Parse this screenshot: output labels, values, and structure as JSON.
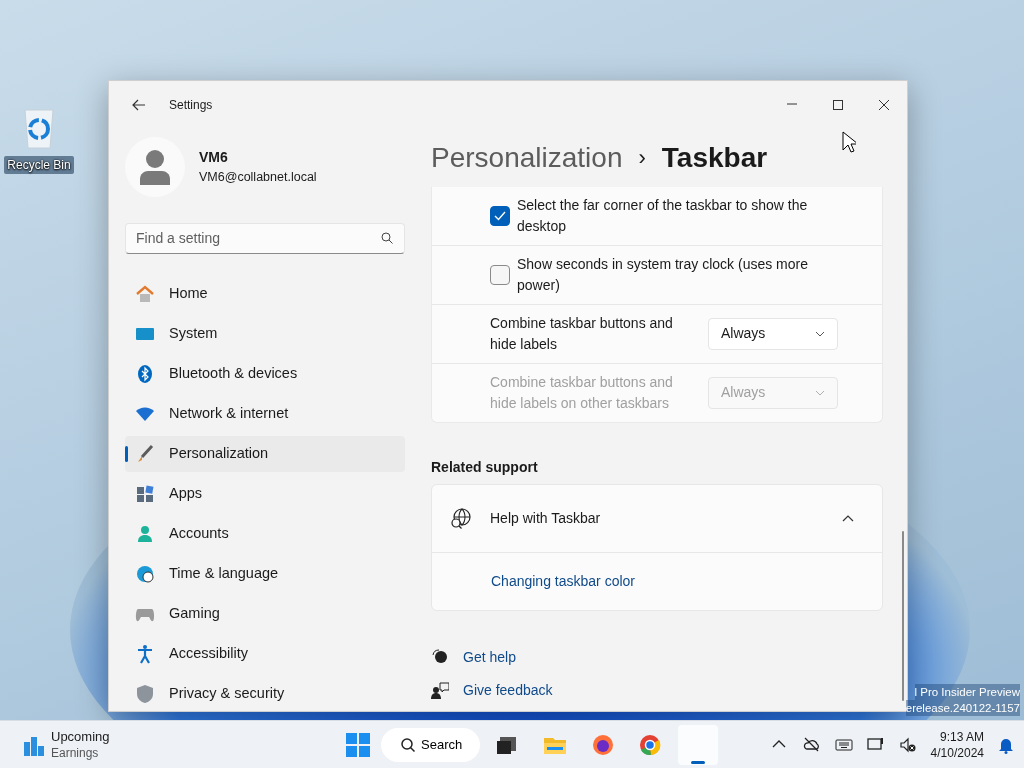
{
  "desktop": {
    "icons": [
      {
        "label": "Recycle Bin"
      }
    ],
    "watermark": [
      "l Pro Insider Preview",
      "erelease.240122-1157"
    ]
  },
  "window": {
    "title": "Settings"
  },
  "profile": {
    "name": "VM6",
    "email": "VM6@collabnet.local"
  },
  "search": {
    "placeholder": "Find a setting"
  },
  "sidebar": {
    "items": [
      {
        "label": "Home",
        "selected": false
      },
      {
        "label": "System",
        "selected": false
      },
      {
        "label": "Bluetooth & devices",
        "selected": false
      },
      {
        "label": "Network & internet",
        "selected": false
      },
      {
        "label": "Personalization",
        "selected": true
      },
      {
        "label": "Apps",
        "selected": false
      },
      {
        "label": "Accounts",
        "selected": false
      },
      {
        "label": "Time & language",
        "selected": false
      },
      {
        "label": "Gaming",
        "selected": false
      },
      {
        "label": "Accessibility",
        "selected": false
      },
      {
        "label": "Privacy & security",
        "selected": false
      }
    ]
  },
  "breadcrumb": {
    "parent": "Personalization",
    "separator": "›",
    "current": "Taskbar"
  },
  "settings": [
    {
      "kind": "checkbox",
      "label": "Select the far corner of the taskbar to show the desktop",
      "checked": true
    },
    {
      "kind": "checkbox",
      "label": "Show seconds in system tray clock (uses more power)",
      "checked": false
    },
    {
      "kind": "dropdown",
      "label": "Combine taskbar buttons and hide labels",
      "value": "Always",
      "disabled": false
    },
    {
      "kind": "dropdown",
      "label": "Combine taskbar buttons and hide labels on other taskbars",
      "value": "Always",
      "disabled": true
    }
  ],
  "related_support": {
    "heading": "Related support",
    "expander": {
      "title": "Help with Taskbar",
      "expanded": true,
      "links": [
        "Changing taskbar color"
      ]
    }
  },
  "footer_links": [
    "Get help",
    "Give feedback"
  ],
  "taskbar": {
    "widget": {
      "title": "Upcoming",
      "subtitle": "Earnings"
    },
    "search": "Search",
    "apps": [
      {
        "selected": false
      },
      {
        "selected": false
      },
      {
        "selected": false
      },
      {
        "selected": false
      },
      {
        "selected": true
      }
    ],
    "time": "9:13 AM",
    "date": "4/10/2024"
  }
}
